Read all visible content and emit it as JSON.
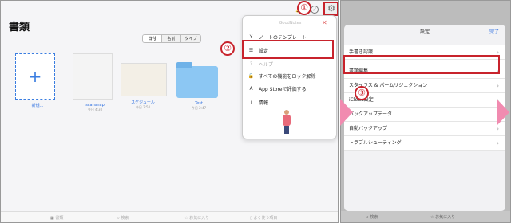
{
  "left": {
    "title": "書類",
    "sort_tabs": [
      "日付",
      "名前",
      "タイプ"
    ],
    "items": [
      {
        "name": "新規...",
        "sub": ""
      },
      {
        "name": "scansnap",
        "sub": "今日 4:30"
      },
      {
        "name": "スケジュール",
        "sub": "今日 2:50"
      },
      {
        "name": "Test",
        "sub": "今日 2:47"
      }
    ],
    "tabbar": [
      "書類",
      "検索",
      "お気に入り",
      "よく使う項目"
    ]
  },
  "menu": {
    "header": "GoodNotes",
    "close_icon": "close-icon",
    "items": [
      {
        "icon": "tuning-fork-icon",
        "glyph": "Y",
        "label": "ノートのテンプレート"
      },
      {
        "icon": "list-icon",
        "glyph": "☰",
        "label": "設定"
      },
      {
        "icon": "question-icon",
        "glyph": "?",
        "label": "ヘルプ"
      },
      {
        "icon": "lock-icon",
        "glyph": "🔒",
        "label": "すべての機能をロック解除"
      },
      {
        "icon": "appstore-icon",
        "glyph": "A",
        "label": "App Storeで評価する"
      },
      {
        "icon": "info-icon",
        "glyph": "i",
        "label": "情報"
      }
    ]
  },
  "right": {
    "title": "設定",
    "done": "完了",
    "rows": [
      "手書き認識",
      "書類編集",
      "スタイラス & パームリジェクション",
      "iCloud設定",
      "バックアップデータ",
      "自動バックアップ",
      "トラブルシューティング"
    ],
    "tabbar": [
      "検索",
      "お気に入り"
    ]
  },
  "badges": [
    "①",
    "②",
    "③"
  ],
  "colors": {
    "highlight": "#c8232c",
    "accent": "#2a6de0",
    "arrow": "#f18bb0"
  }
}
